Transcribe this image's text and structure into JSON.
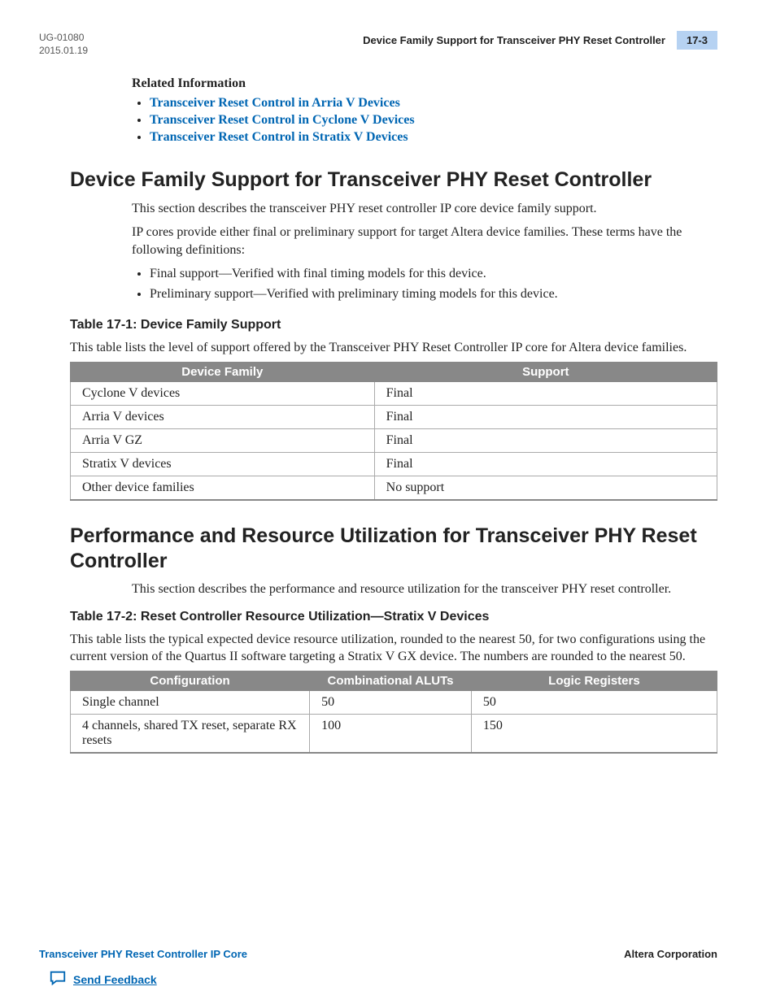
{
  "header": {
    "doc_id": "UG-01080",
    "date": "2015.01.19",
    "section_title": "Device Family Support for Transceiver PHY Reset Controller",
    "page": "17-3"
  },
  "related_info": {
    "heading": "Related Information",
    "links": [
      "Transceiver Reset Control in Arria V Devices",
      "Transceiver Reset Control in Cyclone V Devices",
      "Transceiver Reset Control in Stratix V Devices"
    ]
  },
  "section1": {
    "heading": "Device Family Support for Transceiver PHY Reset Controller",
    "p1": "This section describes the transceiver PHY reset controller IP core device family support.",
    "p2": "IP cores provide either final or preliminary support for target Altera device families. These terms have the following definitions:",
    "defs": [
      "Final support—Verified with final timing models for this device.",
      "Preliminary support—Verified with preliminary timing models for this device."
    ],
    "table_title": "Table 17-1: Device Family Support",
    "table_caption": "This table lists the level of support offered by the Transceiver PHY Reset Controller IP core for Altera device families.",
    "table": {
      "headers": [
        "Device Family",
        "Support"
      ],
      "rows": [
        [
          "Cyclone V devices",
          "Final"
        ],
        [
          "Arria V devices",
          "Final"
        ],
        [
          "Arria V GZ",
          "Final"
        ],
        [
          "Stratix V devices",
          "Final"
        ],
        [
          "Other device families",
          "No support"
        ]
      ]
    }
  },
  "section2": {
    "heading": "Performance and Resource Utilization for Transceiver PHY Reset Controller",
    "p1": "This section describes the performance and resource utilization for the transceiver PHY reset controller.",
    "table_title": "Table 17-2: Reset Controller Resource Utilization—Stratix V Devices",
    "table_caption": "This table lists the typical expected device resource utilization, rounded to the nearest 50, for two configurations using the current version of the Quartus II software targeting a Stratix V GX device. The numbers are rounded to the nearest 50.",
    "table": {
      "headers": [
        "Configuration",
        "Combinational ALUTs",
        "Logic Registers"
      ],
      "rows": [
        [
          "Single channel",
          "50",
          "50"
        ],
        [
          "4 channels, shared TX reset, separate RX resets",
          "100",
          "150"
        ]
      ]
    }
  },
  "footer": {
    "left": "Transceiver PHY Reset Controller IP Core",
    "right": "Altera Corporation",
    "feedback": "Send Feedback"
  }
}
